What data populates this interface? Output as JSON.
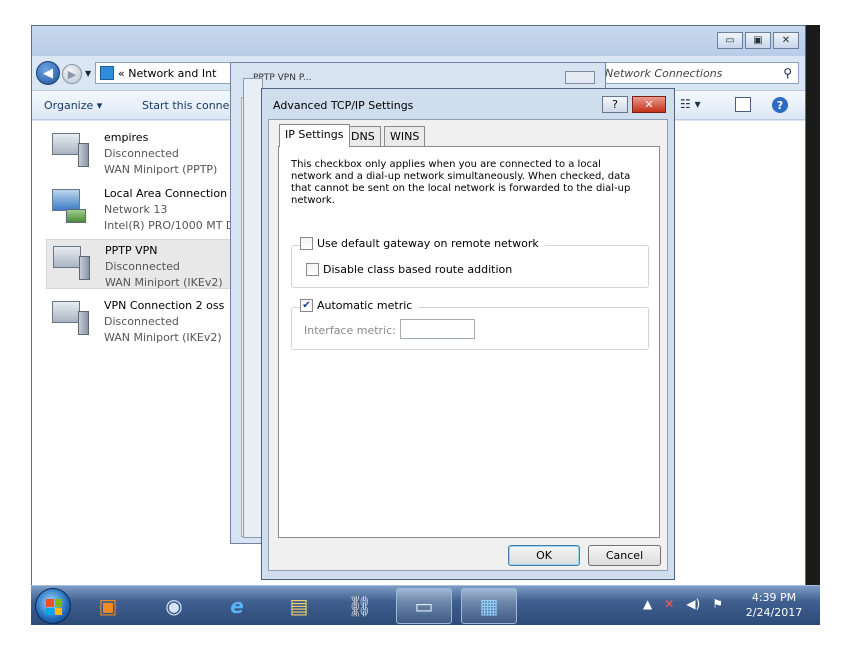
{
  "explorer": {
    "address_chevron": "«",
    "address_text": "Network and Int",
    "search_text": "Network Connections",
    "toolbar": {
      "organize": "Organize ▾",
      "start": "Start this connec"
    },
    "caption": {
      "minimize": "▭",
      "maximize": "▣",
      "close": "✕"
    },
    "connections": [
      {
        "name": "empires",
        "status": "Disconnected",
        "device": "WAN Miniport (PPTP)"
      },
      {
        "name": "Local Area Connection",
        "status": "Network  13",
        "device": "Intel(R) PRO/1000 MT D"
      },
      {
        "name": "PPTP VPN",
        "status": "Disconnected",
        "device": "WAN Miniport (IKEv2)"
      },
      {
        "name": "VPN Connection 2 oss",
        "status": "Disconnected",
        "device": "WAN Miniport (IKEv2)"
      }
    ]
  },
  "background_dialog": {
    "title_fragment": "PPTP VPN P..."
  },
  "dialog": {
    "title": "Advanced TCP/IP Settings",
    "help_glyph": "?",
    "close_glyph": "✕",
    "tabs": [
      "IP Settings",
      "DNS",
      "WINS"
    ],
    "description": "This checkbox only applies when you are connected to a local network and a dial-up network simultaneously.  When checked, data that cannot be sent on the local network is forwarded to the dial-up network.",
    "use_default_gateway": {
      "label": "Use default gateway on remote network",
      "checked": false
    },
    "disable_class_route": {
      "label": "Disable class based route addition",
      "checked": false
    },
    "automatic_metric": {
      "label": "Automatic metric",
      "checked": true
    },
    "interface_metric_label": "Interface metric:",
    "interface_metric_value": "",
    "ok": "OK",
    "cancel": "Cancel"
  },
  "taskbar": {
    "clock_time": "4:39 PM",
    "clock_date": "2/24/2017",
    "tray": {
      "arrow": "▲",
      "network": "✕",
      "volume": "◀)",
      "flag": "⚑"
    }
  },
  "colors": {
    "dialog_frame": "#cfdded",
    "taskbar": "#3f5f8f",
    "selection": "#e8e8e8"
  }
}
